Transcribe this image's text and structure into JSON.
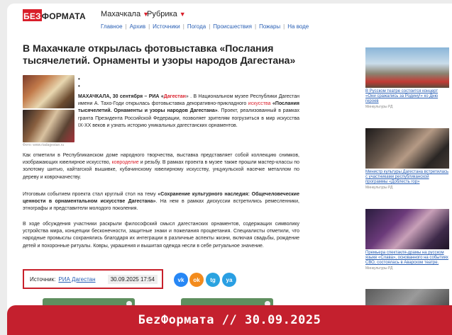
{
  "header": {
    "logo_prefix": "БЕЗ",
    "logo_suffix": "ФОРМАТА",
    "city": "Махачкала",
    "rubric": "Рубрика",
    "nav": [
      "Главное",
      "Архив",
      "Источники",
      "Погода",
      "Происшествия",
      "Пожары",
      "На воде"
    ]
  },
  "article": {
    "title": "В Махачкале открылась фотовыставка «Послания тысячелетий. Орнаменты и узоры народов Дагестана»",
    "photo_credit": "Фото: www.riadagestan.ru",
    "lead_prefix": "МАХАЧКАЛА, 30 сентября – РИА «",
    "lead_source": "Дагестан",
    "lead_middle": "» . В Национальном музее Республики Дагестан имени А. Тахо-Годи открылась фотовыставка декоративно-прикладного ",
    "lead_link": "искусства",
    "lead_bold": " «Послания тысячелетий. Орнаменты и узоры народов Дагестана»",
    "lead_rest": ". Проект, реализованный в рамках гранта Президента Российской Федерации, позволяет зрителям погрузиться в мир искусства IX-XX веков и узнать историю уникальных дагестанских орнаментов.",
    "para1_a": "Как отметили в Республиканском доме народного творчества, выставка представляет собой коллекцию снимков, изображающих ювелирное искусство, ",
    "para1_link": "ковроделие",
    "para1_b": " и резьбу. В рамках проекта в музее также прошли мастер-классы по золотому шитью, кайтагской вышивке, кубачинскому ювелирному искусству, унцукульской насечке металлом по дереву и коврочкачеству.",
    "para2_a": "Итоговым событием проекта стал круглый стол на тему ",
    "para2_bold": "«Сохранение культурного наследия: Общечеловеческие ценности в орнаментальном искусстве Дагестана»",
    "para2_b": ". На нем в рамках дискуссии встретились ремесленники, этнографы и представители молодого поколения.",
    "para3": "В ходе обсуждения участники раскрыли философский смысл дагестанских орнаментов, содержащих символику устройства мира, концепции бесконечности, защитные знаки и пожелания процветания. Специалисты отметили, что народные промыслы сохранялись благодаря их интеграции в различные аспекты жизни, включая свадьбы, рождение детей и похоронные ритуалы. Ковры, украшения и вышитая одежда несли в себе ритуальное значение."
  },
  "source": {
    "label": "Источник:",
    "name": "РИА Дагестан",
    "date": "30.09.2025 17:54"
  },
  "share": {
    "vk": "vk",
    "ok": "ok",
    "tg": "tg",
    "ya": "ya"
  },
  "sidebar": [
    {
      "title": "В Русском театре состоится концерт «Они сражались за Родину!» ко Дню героев",
      "source": "Минкультуры РД"
    },
    {
      "title": "Министр культуры Дагестана встретилась с участниками республиканской программы «Доблесть гор»",
      "source": "Минкультуры РД"
    },
    {
      "title": "Премьера спектакля-драмы на русском языке «Слава», основанного на событиях СВО, состоялась в Аварском театре.",
      "source": "Минкультуры РД"
    },
    {
      "title": "",
      "source": ""
    }
  ],
  "banner": {
    "text": "БеzФормата // 30.09.2025"
  },
  "colors": {
    "accent": "#c4202e",
    "link": "#2a60b5"
  }
}
